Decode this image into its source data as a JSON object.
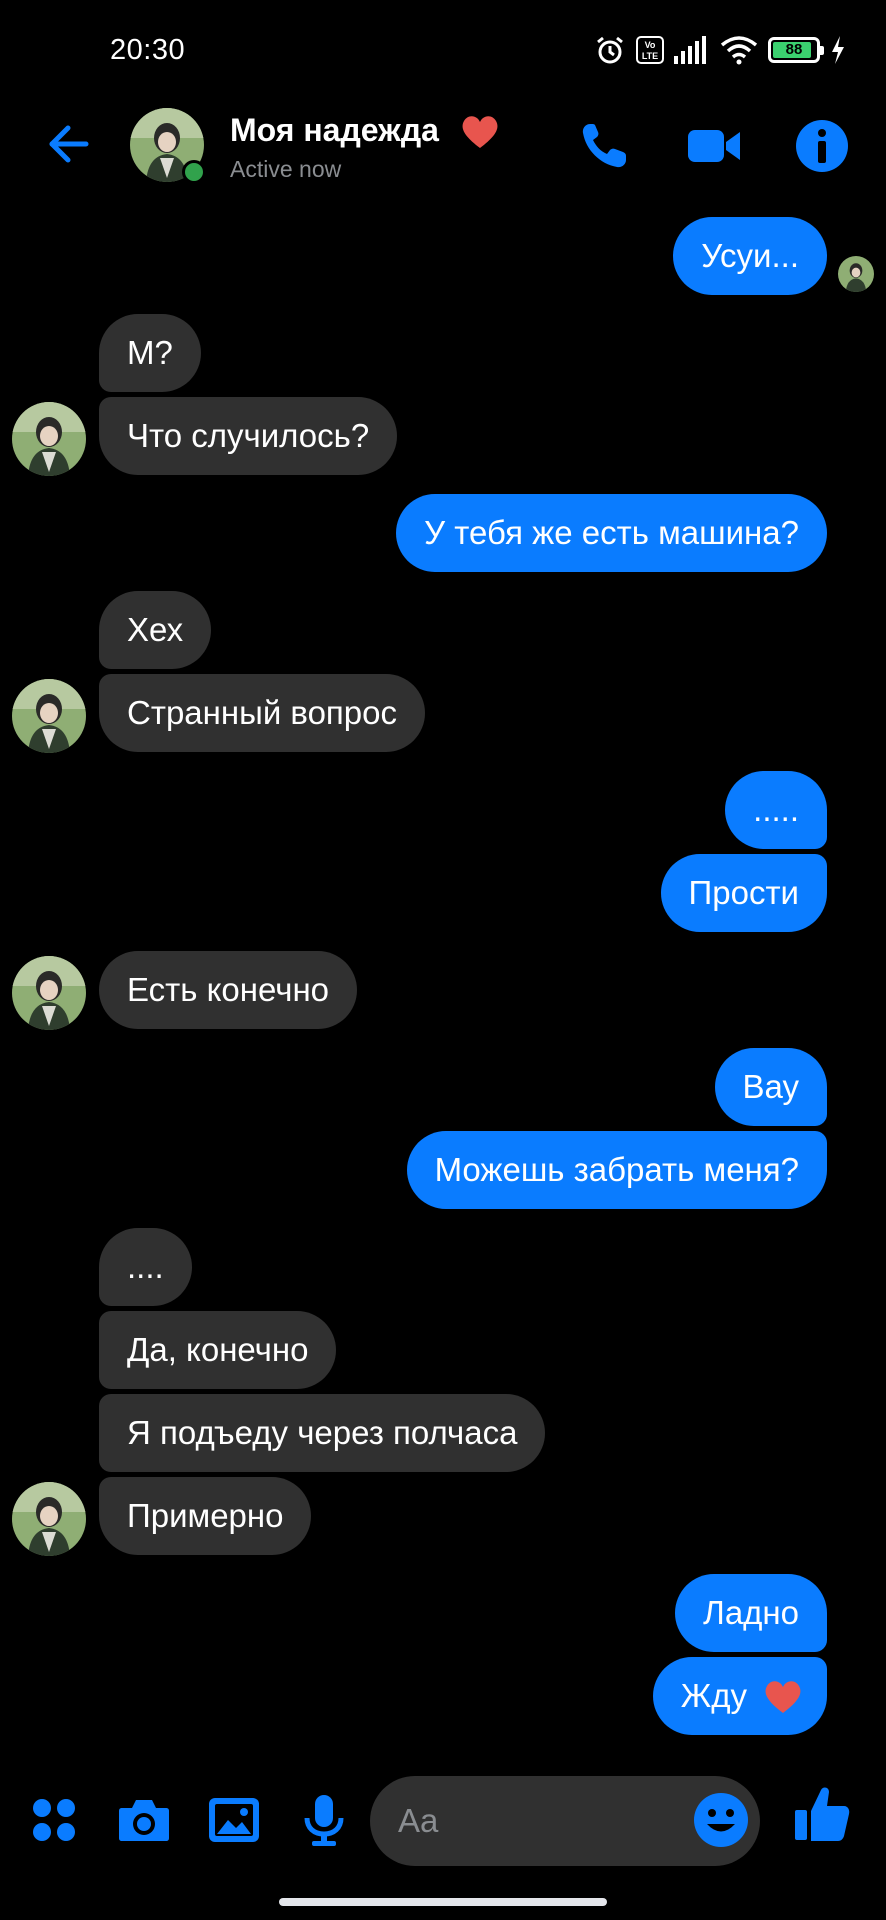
{
  "status_bar": {
    "time": "20:30",
    "volte": "Vo\nLTE",
    "battery": "88"
  },
  "header": {
    "contact_name": "Моя надежда",
    "status": "Active now"
  },
  "messages": [
    {
      "side": "out",
      "text": "Усуи..."
    },
    {
      "side": "in",
      "text": "М?"
    },
    {
      "side": "in",
      "text": "Что случилось?"
    },
    {
      "side": "out",
      "text": "У тебя же есть машина?"
    },
    {
      "side": "in",
      "text": "Хех"
    },
    {
      "side": "in",
      "text": "Странный вопрос"
    },
    {
      "side": "out",
      "text": "....."
    },
    {
      "side": "out",
      "text": "Прости"
    },
    {
      "side": "in",
      "text": "Есть конечно"
    },
    {
      "side": "out",
      "text": "Вау"
    },
    {
      "side": "out",
      "text": "Можешь забрать меня?"
    },
    {
      "side": "in",
      "text": "...."
    },
    {
      "side": "in",
      "text": "Да, конечно"
    },
    {
      "side": "in",
      "text": "Я подъеду через полчаса"
    },
    {
      "side": "in",
      "text": "Примерно"
    },
    {
      "side": "out",
      "text": "Ладно"
    },
    {
      "side": "out",
      "text": "Жду"
    }
  ],
  "composer": {
    "placeholder": "Aa"
  },
  "colors": {
    "accent": "#0a7cff",
    "incoming_bubble": "#303030",
    "online": "#31a24c",
    "heart": "#e8554e"
  }
}
